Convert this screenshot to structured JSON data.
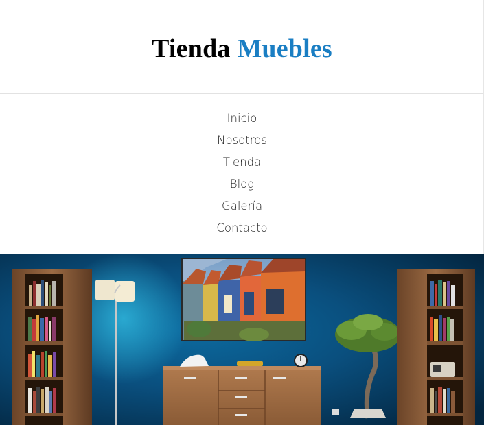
{
  "site": {
    "title_part1": "Tienda",
    "title_part2": "Muebles",
    "accent_color": "#1a7ec3"
  },
  "nav": {
    "items": [
      {
        "label": "Inicio"
      },
      {
        "label": "Nosotros"
      },
      {
        "label": "Tienda"
      },
      {
        "label": "Blog"
      },
      {
        "label": "Galería"
      },
      {
        "label": "Contacto"
      }
    ]
  },
  "hero": {
    "description": "Interior with blue wall, wooden bookshelves, floor lamp, sideboard, painting of colorful houses, bonsai plant"
  }
}
